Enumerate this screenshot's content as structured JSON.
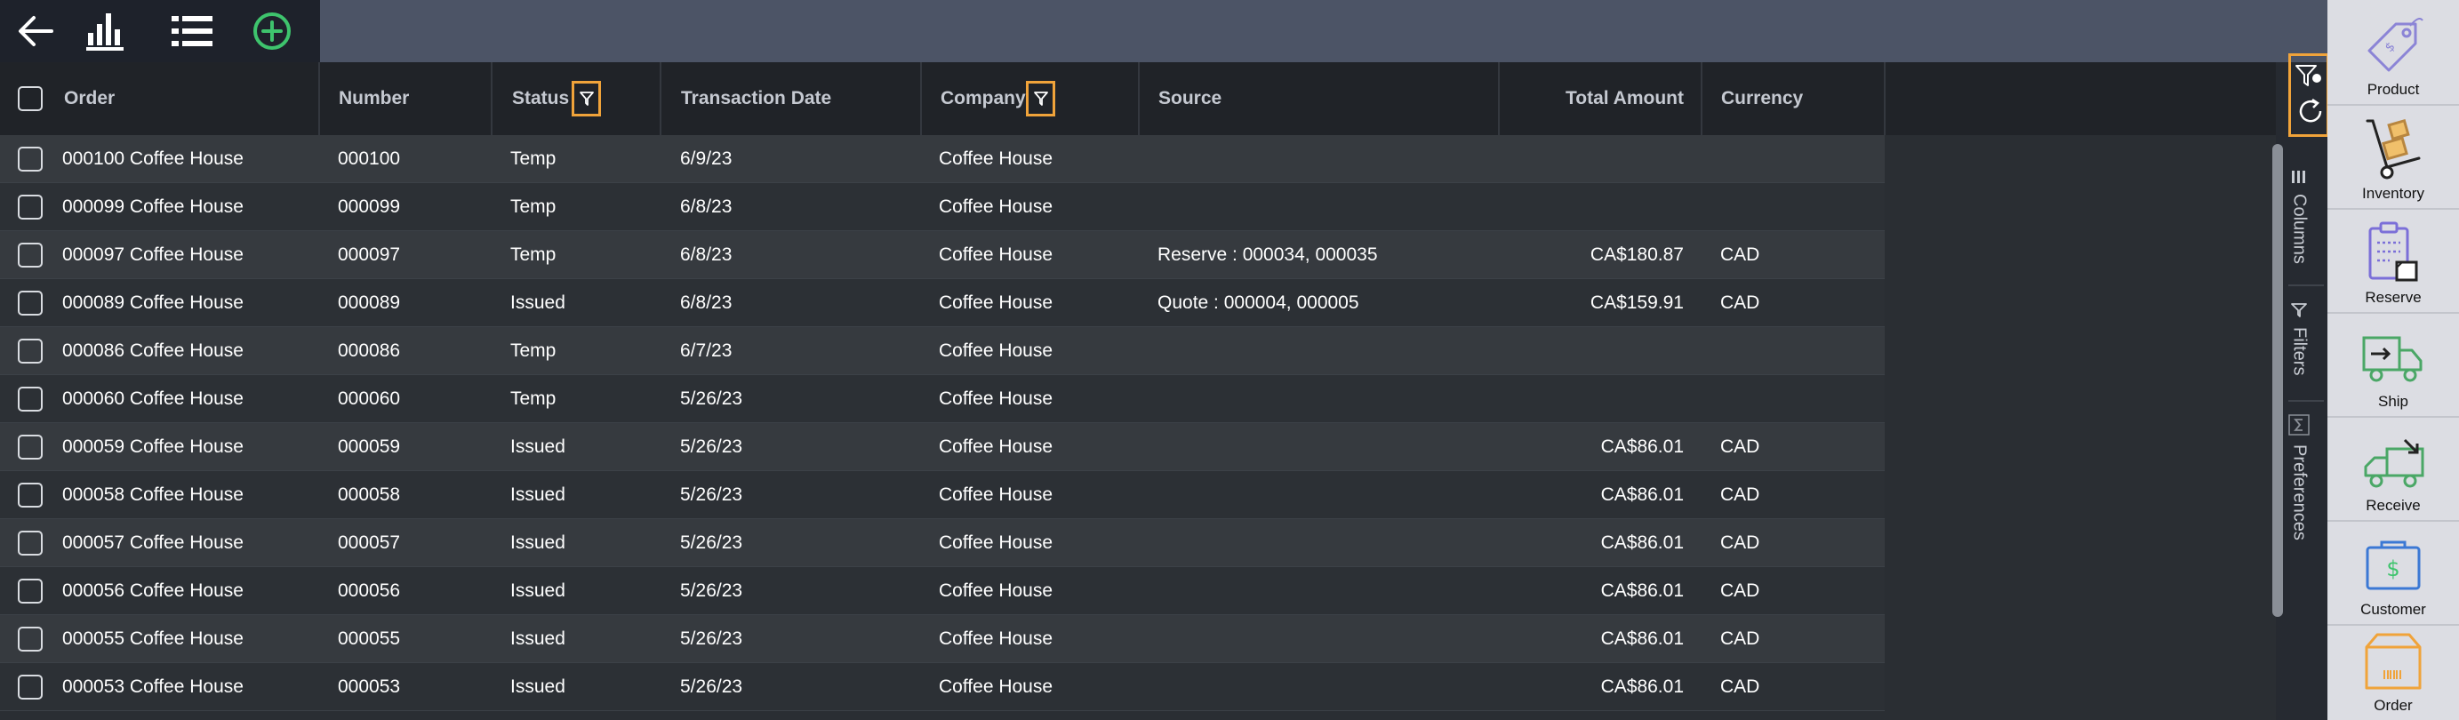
{
  "toolbar": {
    "icons": [
      "back-arrow-icon",
      "bar-chart-icon",
      "list-icon",
      "add-circle-icon"
    ],
    "add_color": "#3ec46d"
  },
  "columns": {
    "order": "Order",
    "number": "Number",
    "status": "Status",
    "transaction_date": "Transaction Date",
    "company": "Company",
    "source": "Source",
    "total_amount": "Total Amount",
    "currency": "Currency"
  },
  "rows": [
    {
      "order": "000100 Coffee House",
      "number": "000100",
      "status": "Temp",
      "date": "6/9/23",
      "company": "Coffee House",
      "source": "",
      "amount": "",
      "currency": ""
    },
    {
      "order": "000099 Coffee House",
      "number": "000099",
      "status": "Temp",
      "date": "6/8/23",
      "company": "Coffee House",
      "source": "",
      "amount": "",
      "currency": ""
    },
    {
      "order": "000097 Coffee House",
      "number": "000097",
      "status": "Temp",
      "date": "6/8/23",
      "company": "Coffee House",
      "source": "Reserve : 000034, 000035",
      "amount": "CA$180.87",
      "currency": "CAD"
    },
    {
      "order": "000089 Coffee House",
      "number": "000089",
      "status": "Issued",
      "date": "6/8/23",
      "company": "Coffee House",
      "source": "Quote : 000004, 000005",
      "amount": "CA$159.91",
      "currency": "CAD"
    },
    {
      "order": "000086 Coffee House",
      "number": "000086",
      "status": "Temp",
      "date": "6/7/23",
      "company": "Coffee House",
      "source": "",
      "amount": "",
      "currency": ""
    },
    {
      "order": "000060 Coffee House",
      "number": "000060",
      "status": "Temp",
      "date": "5/26/23",
      "company": "Coffee House",
      "source": "",
      "amount": "",
      "currency": ""
    },
    {
      "order": "000059 Coffee House",
      "number": "000059",
      "status": "Issued",
      "date": "5/26/23",
      "company": "Coffee House",
      "source": "",
      "amount": "CA$86.01",
      "currency": "CAD"
    },
    {
      "order": "000058 Coffee House",
      "number": "000058",
      "status": "Issued",
      "date": "5/26/23",
      "company": "Coffee House",
      "source": "",
      "amount": "CA$86.01",
      "currency": "CAD"
    },
    {
      "order": "000057 Coffee House",
      "number": "000057",
      "status": "Issued",
      "date": "5/26/23",
      "company": "Coffee House",
      "source": "",
      "amount": "CA$86.01",
      "currency": "CAD"
    },
    {
      "order": "000056 Coffee House",
      "number": "000056",
      "status": "Issued",
      "date": "5/26/23",
      "company": "Coffee House",
      "source": "",
      "amount": "CA$86.01",
      "currency": "CAD"
    },
    {
      "order": "000055 Coffee House",
      "number": "000055",
      "status": "Issued",
      "date": "5/26/23",
      "company": "Coffee House",
      "source": "",
      "amount": "CA$86.01",
      "currency": "CAD"
    },
    {
      "order": "000053 Coffee House",
      "number": "000053",
      "status": "Issued",
      "date": "5/26/23",
      "company": "Coffee House",
      "source": "",
      "amount": "CA$86.01",
      "currency": "CAD"
    }
  ],
  "side_panel": {
    "columns": "Columns",
    "filters": "Filters",
    "preferences": "Preferences"
  },
  "nav": {
    "product": "Product",
    "inventory": "Inventory",
    "reserve": "Reserve",
    "ship": "Ship",
    "receive": "Receive",
    "customer": "Customer",
    "order": "Order"
  },
  "colors": {
    "highlight": "#f0a33a",
    "product": "#8b84d6",
    "reserve": "#7b6fd8",
    "ship": "#4aa766",
    "customer": "#3b78d4",
    "order": "#f0a33a"
  }
}
